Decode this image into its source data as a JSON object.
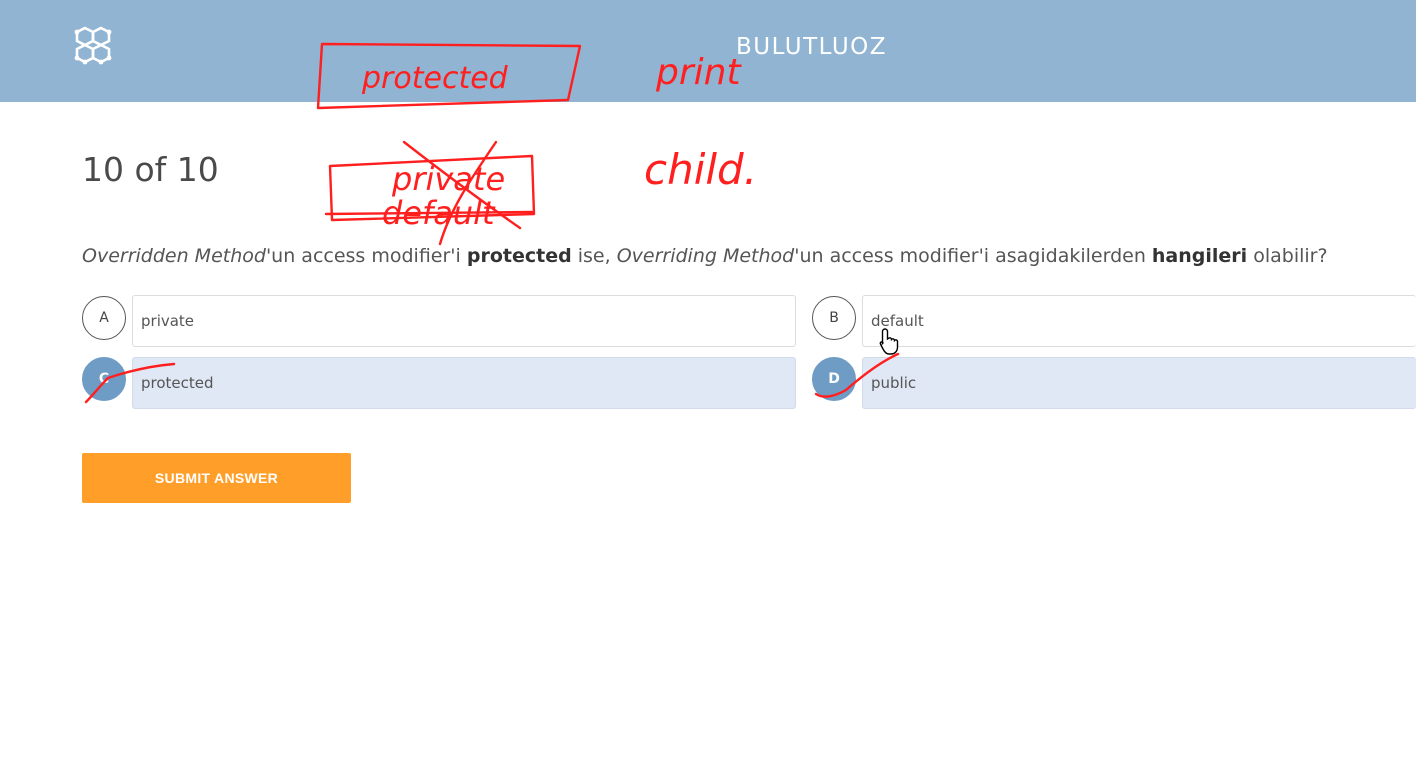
{
  "header": {
    "brand": "BULUTLUOZ",
    "logo_icon": "hexagon-network-icon"
  },
  "quiz": {
    "progress": "10 of 10",
    "question": {
      "part1": "Overridden Method",
      "part2": "'un access modifier'i ",
      "part3": "protected",
      "part4": " ise, ",
      "part5": "Overriding Method",
      "part6": "'un access modifier'i asagidakilerden ",
      "part7": "hangileri",
      "part8": " olabilir?"
    },
    "options": [
      {
        "letter": "A",
        "text": "private",
        "selected": false
      },
      {
        "letter": "B",
        "text": "default",
        "selected": false
      },
      {
        "letter": "C",
        "text": "protected",
        "selected": true
      },
      {
        "letter": "D",
        "text": "public",
        "selected": true
      }
    ],
    "submit_label": "SUBMIT ANSWER"
  },
  "annotations": {
    "boxed_word": "protected",
    "word_top_right": "print",
    "crossed_word_1": "private",
    "crossed_word_2": "default",
    "word_right": "child."
  },
  "colors": {
    "header_bg": "#91b4d2",
    "selected_circle": "#6f9cc5",
    "selected_option_bg": "#e1e8f5",
    "submit_bg": "#ff9f2a",
    "ink": "#ff1f1f"
  }
}
